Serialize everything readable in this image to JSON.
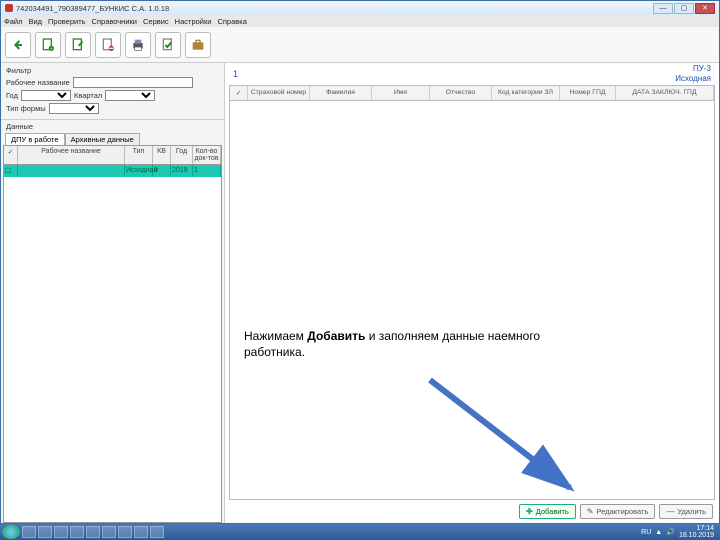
{
  "window": {
    "title": "742034491_790389477_БУНКИС С.А. 1.0.18",
    "min": "—",
    "max": "▢",
    "close": "✕"
  },
  "menu": [
    "Файл",
    "Вид",
    "Проверить",
    "Справочники",
    "Сервис",
    "Настройки",
    "Справка"
  ],
  "filter": {
    "header": "Фильтр",
    "label_name": "Рабочее название",
    "label_year": "Год",
    "label_quarter": "Квартал",
    "label_form_type": "Тип формы"
  },
  "data_section": {
    "header": "Данные",
    "tab1": "ДПУ в работе",
    "tab2": "Архивные данные"
  },
  "left_table": {
    "cols": [
      "✓",
      "Рабочее название",
      "Тип",
      "КВ",
      "Год",
      "Кол-во док-тов"
    ],
    "row": {
      "check": "☐",
      "name": "",
      "type": "Исходная",
      "kv": "0",
      "year": "2019",
      "count": "1"
    }
  },
  "right_header": {
    "number": "1",
    "code": "ПУ-3",
    "sub": "Исходная"
  },
  "right_table_cols": [
    "✓",
    "Страховой номер",
    "Фамилия",
    "Имя",
    "Отчество",
    "Код категории ЗЛ",
    "Номер ГПД",
    "ДАТА ЗАКЛЮЧ. ГПД"
  ],
  "buttons": {
    "add": "Добавить",
    "edit": "Редактировать",
    "delete": "Удалить"
  },
  "annotation": {
    "line1a": "Нажимаем ",
    "line1b": "Добавить",
    "line1c": " и заполняем данные наемного",
    "line2": "работника."
  },
  "tray": {
    "lang": "RU",
    "time": "17:14",
    "date": "18.10.2019"
  }
}
